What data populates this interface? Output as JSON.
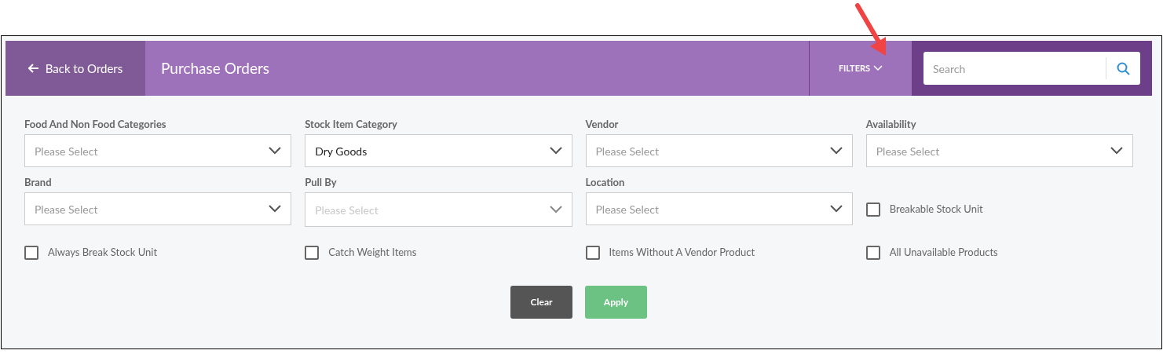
{
  "header": {
    "back_link": "Back to Orders",
    "title": "Purchase Orders",
    "filters_toggle": {
      "label": "FILTERS",
      "expanded": true
    },
    "search": {
      "placeholder": "Search"
    }
  },
  "filters": [
    {
      "kind": "select",
      "label": "Food And Non Food Categories",
      "placeholder": "Please Select",
      "disabled": false
    },
    {
      "kind": "select",
      "label": "Stock Item Category",
      "value": "Dry Goods",
      "disabled": false
    },
    {
      "kind": "select",
      "label": "Vendor",
      "placeholder": "Please Select",
      "disabled": false
    },
    {
      "kind": "select",
      "label": "Availability",
      "placeholder": "Please Select",
      "disabled": false
    },
    {
      "kind": "select",
      "label": "Brand",
      "placeholder": "Please Select",
      "disabled": false
    },
    {
      "kind": "select",
      "label": "Pull By",
      "placeholder": "Please Select",
      "disabled": true
    },
    {
      "kind": "select",
      "label": "Location",
      "placeholder": "Please Select",
      "disabled": false
    },
    {
      "kind": "checkbox",
      "label": "Breakable Stock Unit",
      "checked": false
    },
    {
      "kind": "checkbox",
      "label": "Always Break Stock Unit",
      "checked": false
    },
    {
      "kind": "checkbox",
      "label": "Catch Weight Items",
      "checked": false
    },
    {
      "kind": "checkbox",
      "label": "Items Without A Vendor Product",
      "checked": false
    },
    {
      "kind": "checkbox",
      "label": "All Unavailable Products",
      "checked": false
    }
  ],
  "buttons": [
    {
      "kind": "secondary",
      "label": "Clear"
    },
    {
      "kind": "primary",
      "label": "Apply"
    }
  ]
}
